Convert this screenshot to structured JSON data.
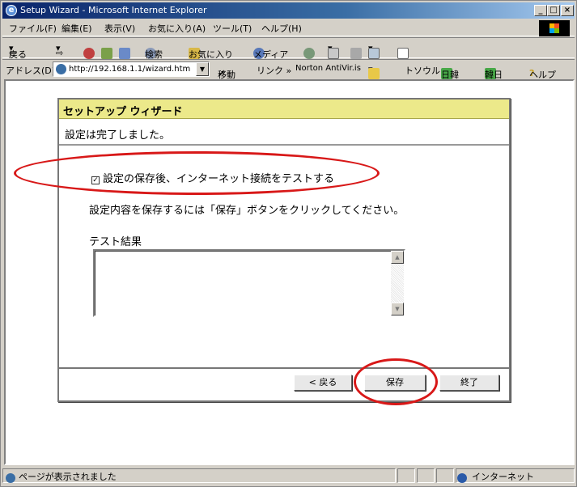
{
  "window": {
    "title": "Setup Wizard - Microsoft Internet Explorer",
    "minimize": "_",
    "maximize": "□",
    "close": "×"
  },
  "menu": [
    "ファイル(F)",
    "編集(E)",
    "表示(V)",
    "お気に入り(A)",
    "ツール(T)",
    "ヘルプ(H)"
  ],
  "toolbar": {
    "back": "戻る",
    "search": "検索",
    "favorites": "お気に入り",
    "media": "メディア"
  },
  "address": {
    "label": "アドレス(D)",
    "url": "http://192.168.1.1/wizard.htm",
    "go": "移動",
    "links": "リンク »",
    "norton": "Norton AntiVir.is",
    "search_box": "トソウル",
    "link1": "日韓",
    "link2": "韓日",
    "help": "ヘルプ"
  },
  "wizard": {
    "title": "セットアップ ウィザード",
    "status": "設定は完了しました。",
    "checkbox_label": "設定の保存後、インターネット接続をテストする",
    "checkbox_checked": true,
    "instruction": "設定内容を保存するには「保存」ボタンをクリックしてください。",
    "test_result_label": "テスト結果",
    "test_result_value": "",
    "back_button": "< 戻る",
    "save_button": "保存",
    "finish_button": "終了"
  },
  "status_bar": {
    "message": "ページが表示されました",
    "zone": "インターネット"
  },
  "colors": {
    "header_bg": "#ece98a",
    "annotation": "#d81818",
    "title_bar": "#0a246a"
  }
}
